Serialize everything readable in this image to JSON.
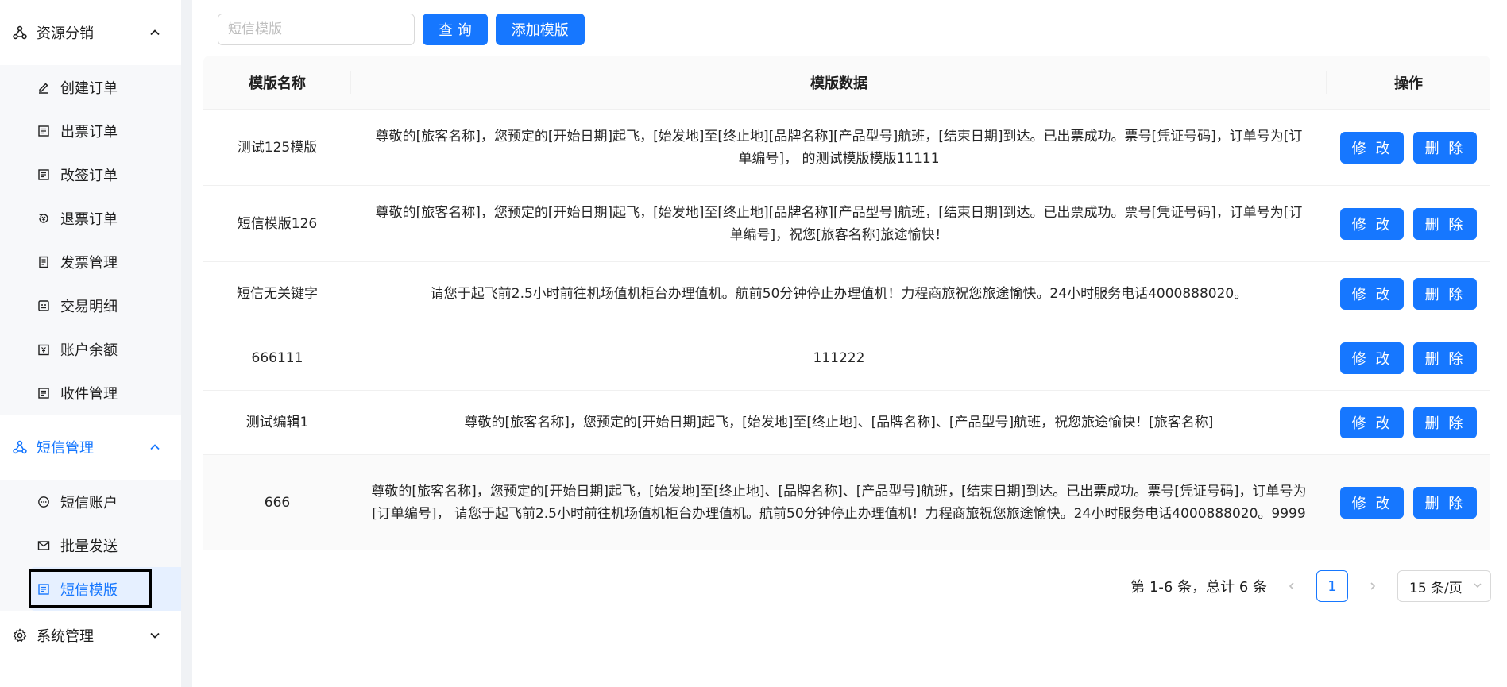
{
  "sidebar": {
    "groups": [
      {
        "label": "资源分销"
      },
      {
        "label": "短信管理"
      },
      {
        "label": "系统管理"
      }
    ],
    "resource_items": [
      {
        "label": "创建订单"
      },
      {
        "label": "出票订单"
      },
      {
        "label": "改签订单"
      },
      {
        "label": "退票订单"
      },
      {
        "label": "发票管理"
      },
      {
        "label": "交易明细"
      },
      {
        "label": "账户余额"
      },
      {
        "label": "收件管理"
      }
    ],
    "sms_items": [
      {
        "label": "短信账户"
      },
      {
        "label": "批量发送"
      },
      {
        "label": "短信模版"
      }
    ]
  },
  "toolbar": {
    "search_placeholder": "短信模版",
    "search_value": "",
    "query_label": "查 询",
    "add_label": "添加模版"
  },
  "table": {
    "headers": {
      "name": "模版名称",
      "data": "模版数据",
      "op": "操作"
    },
    "edit_label": "修 改",
    "delete_label": "删 除",
    "rows": [
      {
        "name": "测试125模版",
        "data": "尊敬的[旅客名称]，您预定的[开始日期]起飞，[始发地]至[终止地][品牌名称][产品型号]航班，[结束日期]到达。已出票成功。票号[凭证号码]，订单号为[订单编号]， 的测试模版模版11111"
      },
      {
        "name": "短信模版126",
        "data": "尊敬的[旅客名称]，您预定的[开始日期]起飞，[始发地]至[终止地][品牌名称][产品型号]航班，[结束日期]到达。已出票成功。票号[凭证号码]，订单号为[订单编号]，祝您[旅客名称]旅途愉快！"
      },
      {
        "name": "短信无关键字",
        "data": "请您于起飞前2.5小时前往机场值机柜台办理值机。航前50分钟停止办理值机！力程商旅祝您旅途愉快。24小时服务电话4000888020。"
      },
      {
        "name": "666111",
        "data": "111222"
      },
      {
        "name": "测试编辑1",
        "data": "尊敬的[旅客名称]，您预定的[开始日期]起飞，[始发地]至[终止地]、[品牌名称]、[产品型号]航班，祝您旅途愉快！[旅客名称]"
      },
      {
        "name": "666",
        "data": "尊敬的[旅客名称]，您预定的[开始日期]起飞，[始发地]至[终止地]、[品牌名称]、[产品型号]航班，[结束日期]到达。已出票成功。票号[凭证号码]，订单号为[订单编号]， 请您于起飞前2.5小时前往机场值机柜台办理值机。航前50分钟停止办理值机！力程商旅祝您旅途愉快。24小时服务电话4000888020。9999"
      }
    ]
  },
  "pagination": {
    "summary": "第 1-6 条，总计 6 条",
    "current_page": "1",
    "page_size": "15 条/页"
  },
  "colors": {
    "primary": "#1677ff",
    "selected_bg": "#e6f0ff"
  }
}
